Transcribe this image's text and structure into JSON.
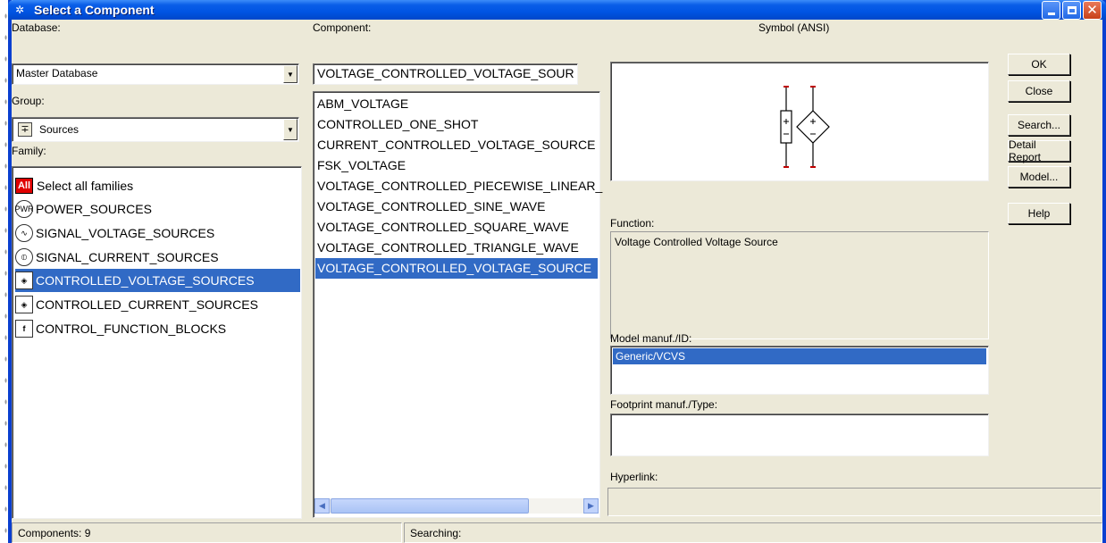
{
  "window": {
    "title": "Select a Component",
    "title_icon": "component-icon"
  },
  "database": {
    "label": "Database:",
    "value": "Master Database"
  },
  "group": {
    "label": "Group:",
    "value": "Sources",
    "icon": "sources-icon"
  },
  "family": {
    "label": "Family:",
    "items": [
      {
        "label": "Select all families",
        "icon": "all-icon"
      },
      {
        "label": "POWER_SOURCES",
        "icon": "pwr-icon"
      },
      {
        "label": "SIGNAL_VOLTAGE_SOURCES",
        "icon": "signal-voltage-icon"
      },
      {
        "label": "SIGNAL_CURRENT_SOURCES",
        "icon": "signal-current-icon"
      },
      {
        "label": "CONTROLLED_VOLTAGE_SOURCES",
        "icon": "controlled-voltage-icon"
      },
      {
        "label": "CONTROLLED_CURRENT_SOURCES",
        "icon": "controlled-current-icon"
      },
      {
        "label": "CONTROL_FUNCTION_BLOCKS",
        "icon": "function-block-icon"
      }
    ],
    "selected_index": 4
  },
  "component": {
    "label": "Component:",
    "value": "VOLTAGE_CONTROLLED_VOLTAGE_SOUR",
    "items": [
      "ABM_VOLTAGE",
      "CONTROLLED_ONE_SHOT",
      "CURRENT_CONTROLLED_VOLTAGE_SOURCE",
      "FSK_VOLTAGE",
      "VOLTAGE_CONTROLLED_PIECEWISE_LINEAR_",
      "VOLTAGE_CONTROLLED_SINE_WAVE",
      "VOLTAGE_CONTROLLED_SQUARE_WAVE",
      "VOLTAGE_CONTROLLED_TRIANGLE_WAVE",
      "VOLTAGE_CONTROLLED_VOLTAGE_SOURCE"
    ],
    "selected_index": 8
  },
  "symbol": {
    "label": "Symbol (ANSI)"
  },
  "function": {
    "label": "Function:",
    "value": "Voltage Controlled Voltage Source"
  },
  "model": {
    "label": "Model manuf./ID:",
    "items": [
      "Generic/VCVS"
    ]
  },
  "footprint": {
    "label": "Footprint manuf./Type:"
  },
  "hyperlink": {
    "label": "Hyperlink:"
  },
  "buttons": {
    "ok": "OK",
    "close": "Close",
    "search": "Search...",
    "detail_report": "Detail Report",
    "model": "Model...",
    "help": "Help"
  },
  "status": {
    "components": "Components: 9",
    "searching": "Searching:"
  },
  "colors": {
    "selection": "#316ac5",
    "titlebar": "#0054e3",
    "dialog_bg": "#ece9d8"
  }
}
